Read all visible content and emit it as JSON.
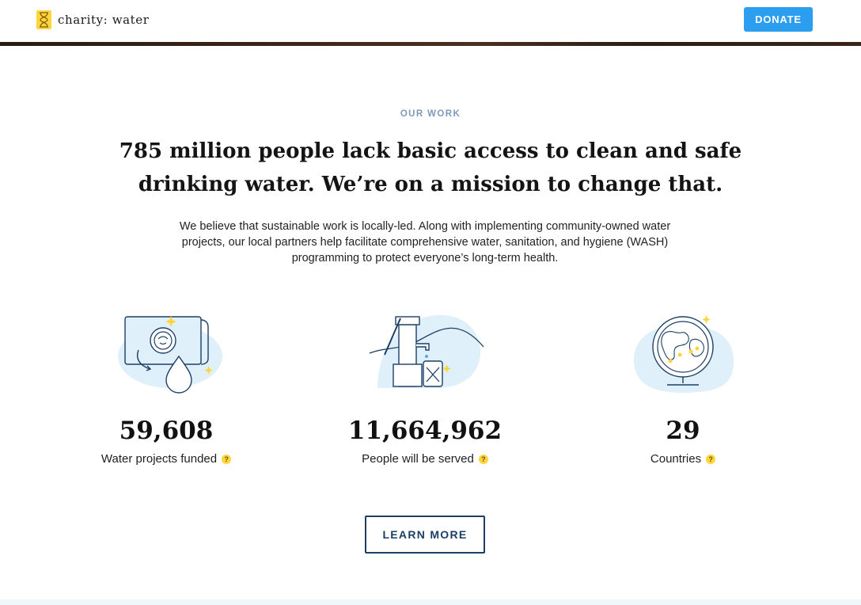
{
  "header": {
    "logo_text": "charity: water",
    "donate_label": "DONATE"
  },
  "intro": {
    "eyebrow": "OUR WORK",
    "headline": "785 million people lack basic access to clean and safe drinking water. We’re on a mission to change that.",
    "body": "We believe that sustainable work is locally-led. Along with implementing community-owned water projects, our local partners help facilitate comprehensive water, sanitation, and hygiene (WASH) programming to protect everyone’s long-term health."
  },
  "stats": [
    {
      "value": "59,608",
      "label": "Water projects funded",
      "icon": "funding-icon",
      "help_icon": "help-icon"
    },
    {
      "value": "11,664,962",
      "label": "People will be served",
      "icon": "water-pump-icon",
      "help_icon": "help-icon"
    },
    {
      "value": "29",
      "label": "Countries",
      "icon": "globe-icon",
      "help_icon": "help-icon"
    }
  ],
  "cta": {
    "learn_more_label": "LEARN MORE"
  },
  "colors": {
    "brand_yellow": "#ffd43d",
    "donate_blue": "#2c9ef0",
    "navy": "#1c3f66",
    "illustration_blue": "#dff0fa"
  }
}
